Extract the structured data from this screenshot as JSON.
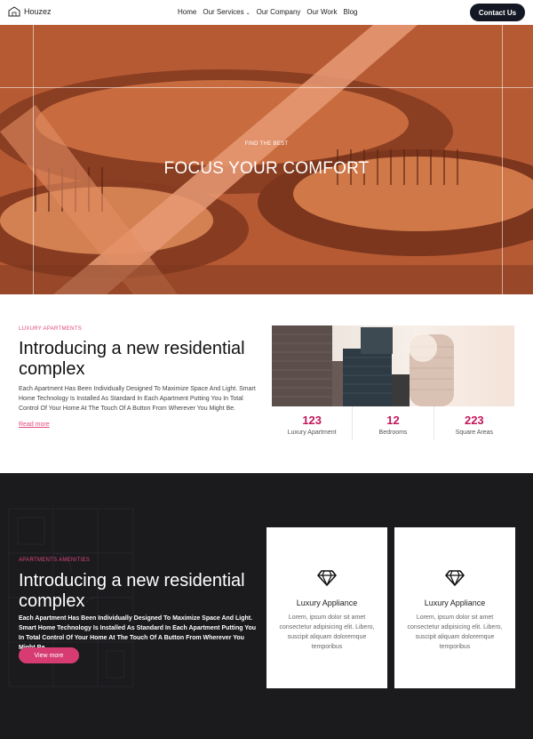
{
  "brand": {
    "name": "Houzez"
  },
  "nav": {
    "items": [
      "Home",
      "Our Services",
      "Our Company",
      "Our Work",
      "Blog"
    ],
    "dropdown_indicator": "⌄",
    "cta": "Contact Us"
  },
  "hero": {
    "subtitle": "FIND THE BEST",
    "title": "FOCUS YOUR COMFORT"
  },
  "intro": {
    "eyebrow": "LUXURY APARTMENTS",
    "title": "Introducing a new residential complex",
    "body": "Each Apartment Has Been Individually Designed To Maximize Space And Light. Smart Home Technology Is Installed As Standard In Each Apartment Putting You In Total Control Of Your Home At The Touch Of A Button From Wherever You Might Be.",
    "link": "Read more"
  },
  "stats": [
    {
      "value": "123",
      "label": "Luxury Apartment"
    },
    {
      "value": "12",
      "label": "Bedrooms"
    },
    {
      "value": "223",
      "label": "Square Areas"
    }
  ],
  "amenities": {
    "eyebrow": "APARTMENTS AMENITIES",
    "title": "Introducing a new residential complex",
    "body": "Each Apartment Has Been Individually Designed To Maximize Space And Light. Smart Home Technology Is Installed As Standard In Each Apartment Putting You In Total Control Of Your Home At The Touch Of A Button From Wherever You Might Be.",
    "button": "View more",
    "cards": [
      {
        "icon": "diamond-icon",
        "title": "Luxury Appliance",
        "body": "Lorem, ipsum dolor sit amet consectetur adipisicing elit. Libero, suscipit aliquam doloremque temporibus"
      },
      {
        "icon": "diamond-icon",
        "title": "Luxury Appliance",
        "body": "Lorem, ipsum dolor sit amet consectetur adipisicing elit. Libero, suscipit aliquam doloremque temporibus"
      }
    ]
  },
  "colors": {
    "accent": "#e0467c",
    "dark": "#1b1b1e",
    "button_dark": "#141824",
    "stat_number": "#c2185b"
  }
}
